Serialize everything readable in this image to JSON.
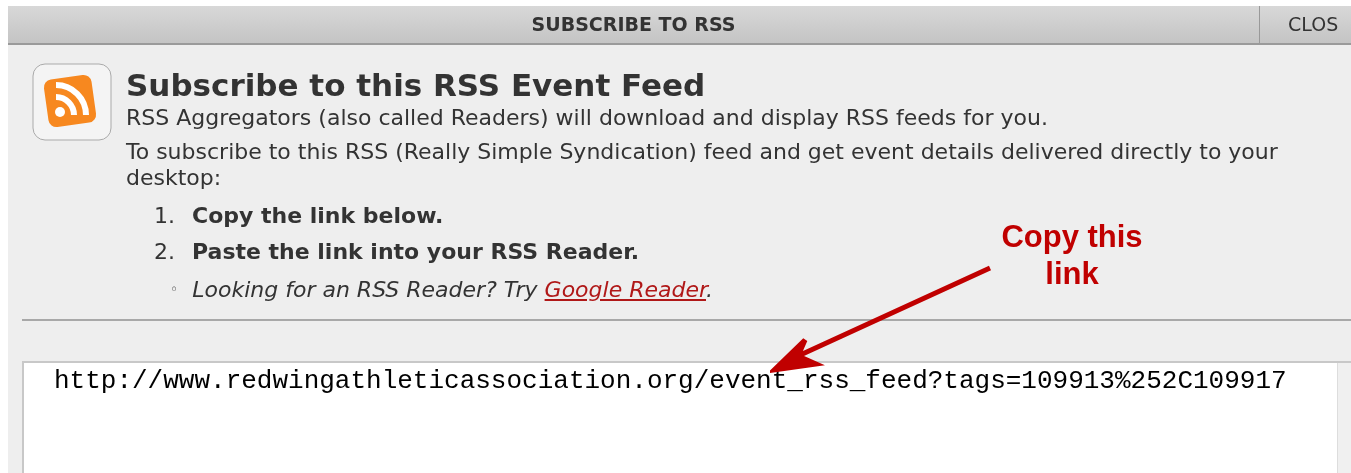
{
  "dialog": {
    "title": "SUBSCRIBE TO RSS",
    "close_button": "CLOS"
  },
  "heading": "Subscribe to this RSS Event Feed",
  "intro": "RSS Aggregators (also called Readers) will download and display RSS feeds for you.",
  "instructions": "To subscribe to this RSS (Really Simple Syndication) feed and get event details delivered directly to your desktop:",
  "steps": [
    {
      "number": "1.",
      "text": "Copy the link below."
    },
    {
      "number": "2.",
      "text": "Paste the link into your RSS Reader."
    }
  ],
  "tip": {
    "bullet": "◦",
    "text": "Looking for an RSS Reader? Try ",
    "link": "Google Reader",
    "after": "."
  },
  "feed_link": {
    "value": "http://www.redwingathleticassociation.org/event_rss_feed?tags=109913%252C109917"
  },
  "annotation": {
    "text": "Copy this\nlink"
  }
}
